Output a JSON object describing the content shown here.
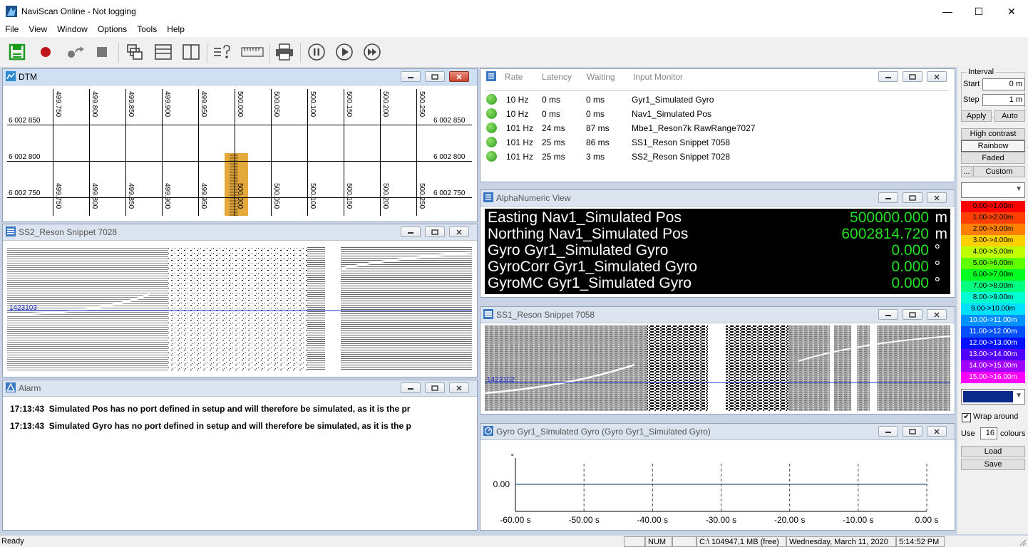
{
  "window": {
    "title": "NaviScan Online - Not logging",
    "minimize": "—",
    "maximize": "☐",
    "close": "✕"
  },
  "menu": [
    "File",
    "View",
    "Window",
    "Options",
    "Tools",
    "Help"
  ],
  "dtm": {
    "title": "DTM",
    "x_ticks": [
      "499.750",
      "499.800",
      "499.850",
      "499.900",
      "499.950",
      "500.000",
      "500.050",
      "500.100",
      "500.150",
      "500.200",
      "500.250"
    ],
    "y_labels": [
      "6 002 850",
      "6 002 800",
      "6 002 750"
    ]
  },
  "ss2": {
    "title": "SS2_Reson Snippet 7028",
    "ping_label": "1423103"
  },
  "alarm": {
    "title": "Alarm",
    "rows": [
      {
        "time": "17:13:43",
        "text": "Simulated Pos has no port defined in setup and will therefore be simulated, as it is the pr"
      },
      {
        "time": "17:13:43",
        "text": "Simulated Gyro has no port defined in setup and will therefore be simulated, as it is the p"
      }
    ]
  },
  "input_monitor": {
    "headers": {
      "rate": "Rate",
      "latency": "Latency",
      "waiting": "Waiting",
      "name": "Input Monitor"
    },
    "rows": [
      {
        "rate": "10 Hz",
        "latency": "0 ms",
        "waiting": "0 ms",
        "name": "Gyr1_Simulated Gyro"
      },
      {
        "rate": "10 Hz",
        "latency": "0 ms",
        "waiting": "0 ms",
        "name": "Nav1_Simulated Pos"
      },
      {
        "rate": "101 Hz",
        "latency": "24 ms",
        "waiting": "87 ms",
        "name": "Mbe1_Reson7k RawRange7027"
      },
      {
        "rate": "101 Hz",
        "latency": "25 ms",
        "waiting": "86 ms",
        "name": "SS1_Reson Snippet 7058"
      },
      {
        "rate": "101 Hz",
        "latency": "25 ms",
        "waiting": "3 ms",
        "name": "SS2_Reson Snippet 7028"
      }
    ]
  },
  "alphanumeric": {
    "title": "AlphaNumeric View",
    "rows": [
      {
        "label": "Easting Nav1_Simulated Pos",
        "value": "500000.000",
        "unit": "m"
      },
      {
        "label": "Northing Nav1_Simulated Pos",
        "value": "6002814.720",
        "unit": "m"
      },
      {
        "label": "Gyro Gyr1_Simulated Gyro",
        "value": "0.000",
        "unit": "°"
      },
      {
        "label": "GyroCorr Gyr1_Simulated Gyro",
        "value": "0.000",
        "unit": "°"
      },
      {
        "label": "GyroMC Gyr1_Simulated Gyro",
        "value": "0.000",
        "unit": "°"
      }
    ]
  },
  "ss1": {
    "title": "SS1_Reson Snippet 7058",
    "ping_label": "1423102"
  },
  "gyro_plot": {
    "title": "Gyro Gyr1_Simulated Gyro (Gyro Gyr1_Simulated Gyro)"
  },
  "chart_data": {
    "type": "line",
    "title": "Gyro Gyr1_Simulated Gyro (Gyro Gyr1_Simulated Gyro)",
    "ylabel": "°",
    "x_ticks": [
      "-60.00 s",
      "-50.00 s",
      "-40.00 s",
      "-30.00 s",
      "-20.00 s",
      "-10.00 s",
      "0.00 s"
    ],
    "x_values": [
      -60,
      -50,
      -40,
      -30,
      -20,
      -10,
      0
    ],
    "y_ticks": [
      "0.00"
    ],
    "series": [
      {
        "x": [
          -60,
          0
        ],
        "y": [
          0,
          0
        ]
      }
    ],
    "xlim": [
      -60,
      0
    ],
    "grid": "vertical dashed"
  },
  "side": {
    "interval_label": "Interval",
    "start_label": "Start",
    "start_value": "0 m",
    "step_label": "Step",
    "step_value": "1 m",
    "apply": "Apply",
    "auto": "Auto",
    "high_contrast": "High contrast",
    "rainbow": "Rainbow",
    "faded": "Faded",
    "custom_dots": "...",
    "custom": "Custom",
    "bands": [
      {
        "label": "0.00->1.00m",
        "color": "#ff0000"
      },
      {
        "label": "1.00->2.00m",
        "color": "#ff4000"
      },
      {
        "label": "2.00->3.00m",
        "color": "#ff8000"
      },
      {
        "label": "3.00->4.00m",
        "color": "#ffd000"
      },
      {
        "label": "4.00->5.00m",
        "color": "#c0ff00"
      },
      {
        "label": "5.00->6.00m",
        "color": "#60ff00"
      },
      {
        "label": "6.00->7.00m",
        "color": "#00ff20"
      },
      {
        "label": "7.00->8.00m",
        "color": "#00ff80"
      },
      {
        "label": "8.00->9.00m",
        "color": "#00ffd0"
      },
      {
        "label": "9.00->10.00m",
        "color": "#00e0ff"
      },
      {
        "label": "10.00->11.00m",
        "color": "#0090ff"
      },
      {
        "label": "11.00->12.00m",
        "color": "#0050ff"
      },
      {
        "label": "12.00->13.00m",
        "color": "#0010ff"
      },
      {
        "label": "13.00->14.00m",
        "color": "#5000ff"
      },
      {
        "label": "14.00->15.00m",
        "color": "#a000ff"
      },
      {
        "label": "15.00->16.00m",
        "color": "#ff00ff"
      }
    ],
    "wrap_label": "Wrap around",
    "use_label": "Use",
    "use_value": "16",
    "colours_label": "colours",
    "load": "Load",
    "save": "Save"
  },
  "status": {
    "ready": "Ready",
    "num": "NUM",
    "disk": "C:\\ 104947,1 MB (free)",
    "date": "Wednesday, March 11, 2020",
    "time": "5:14:52 PM"
  }
}
